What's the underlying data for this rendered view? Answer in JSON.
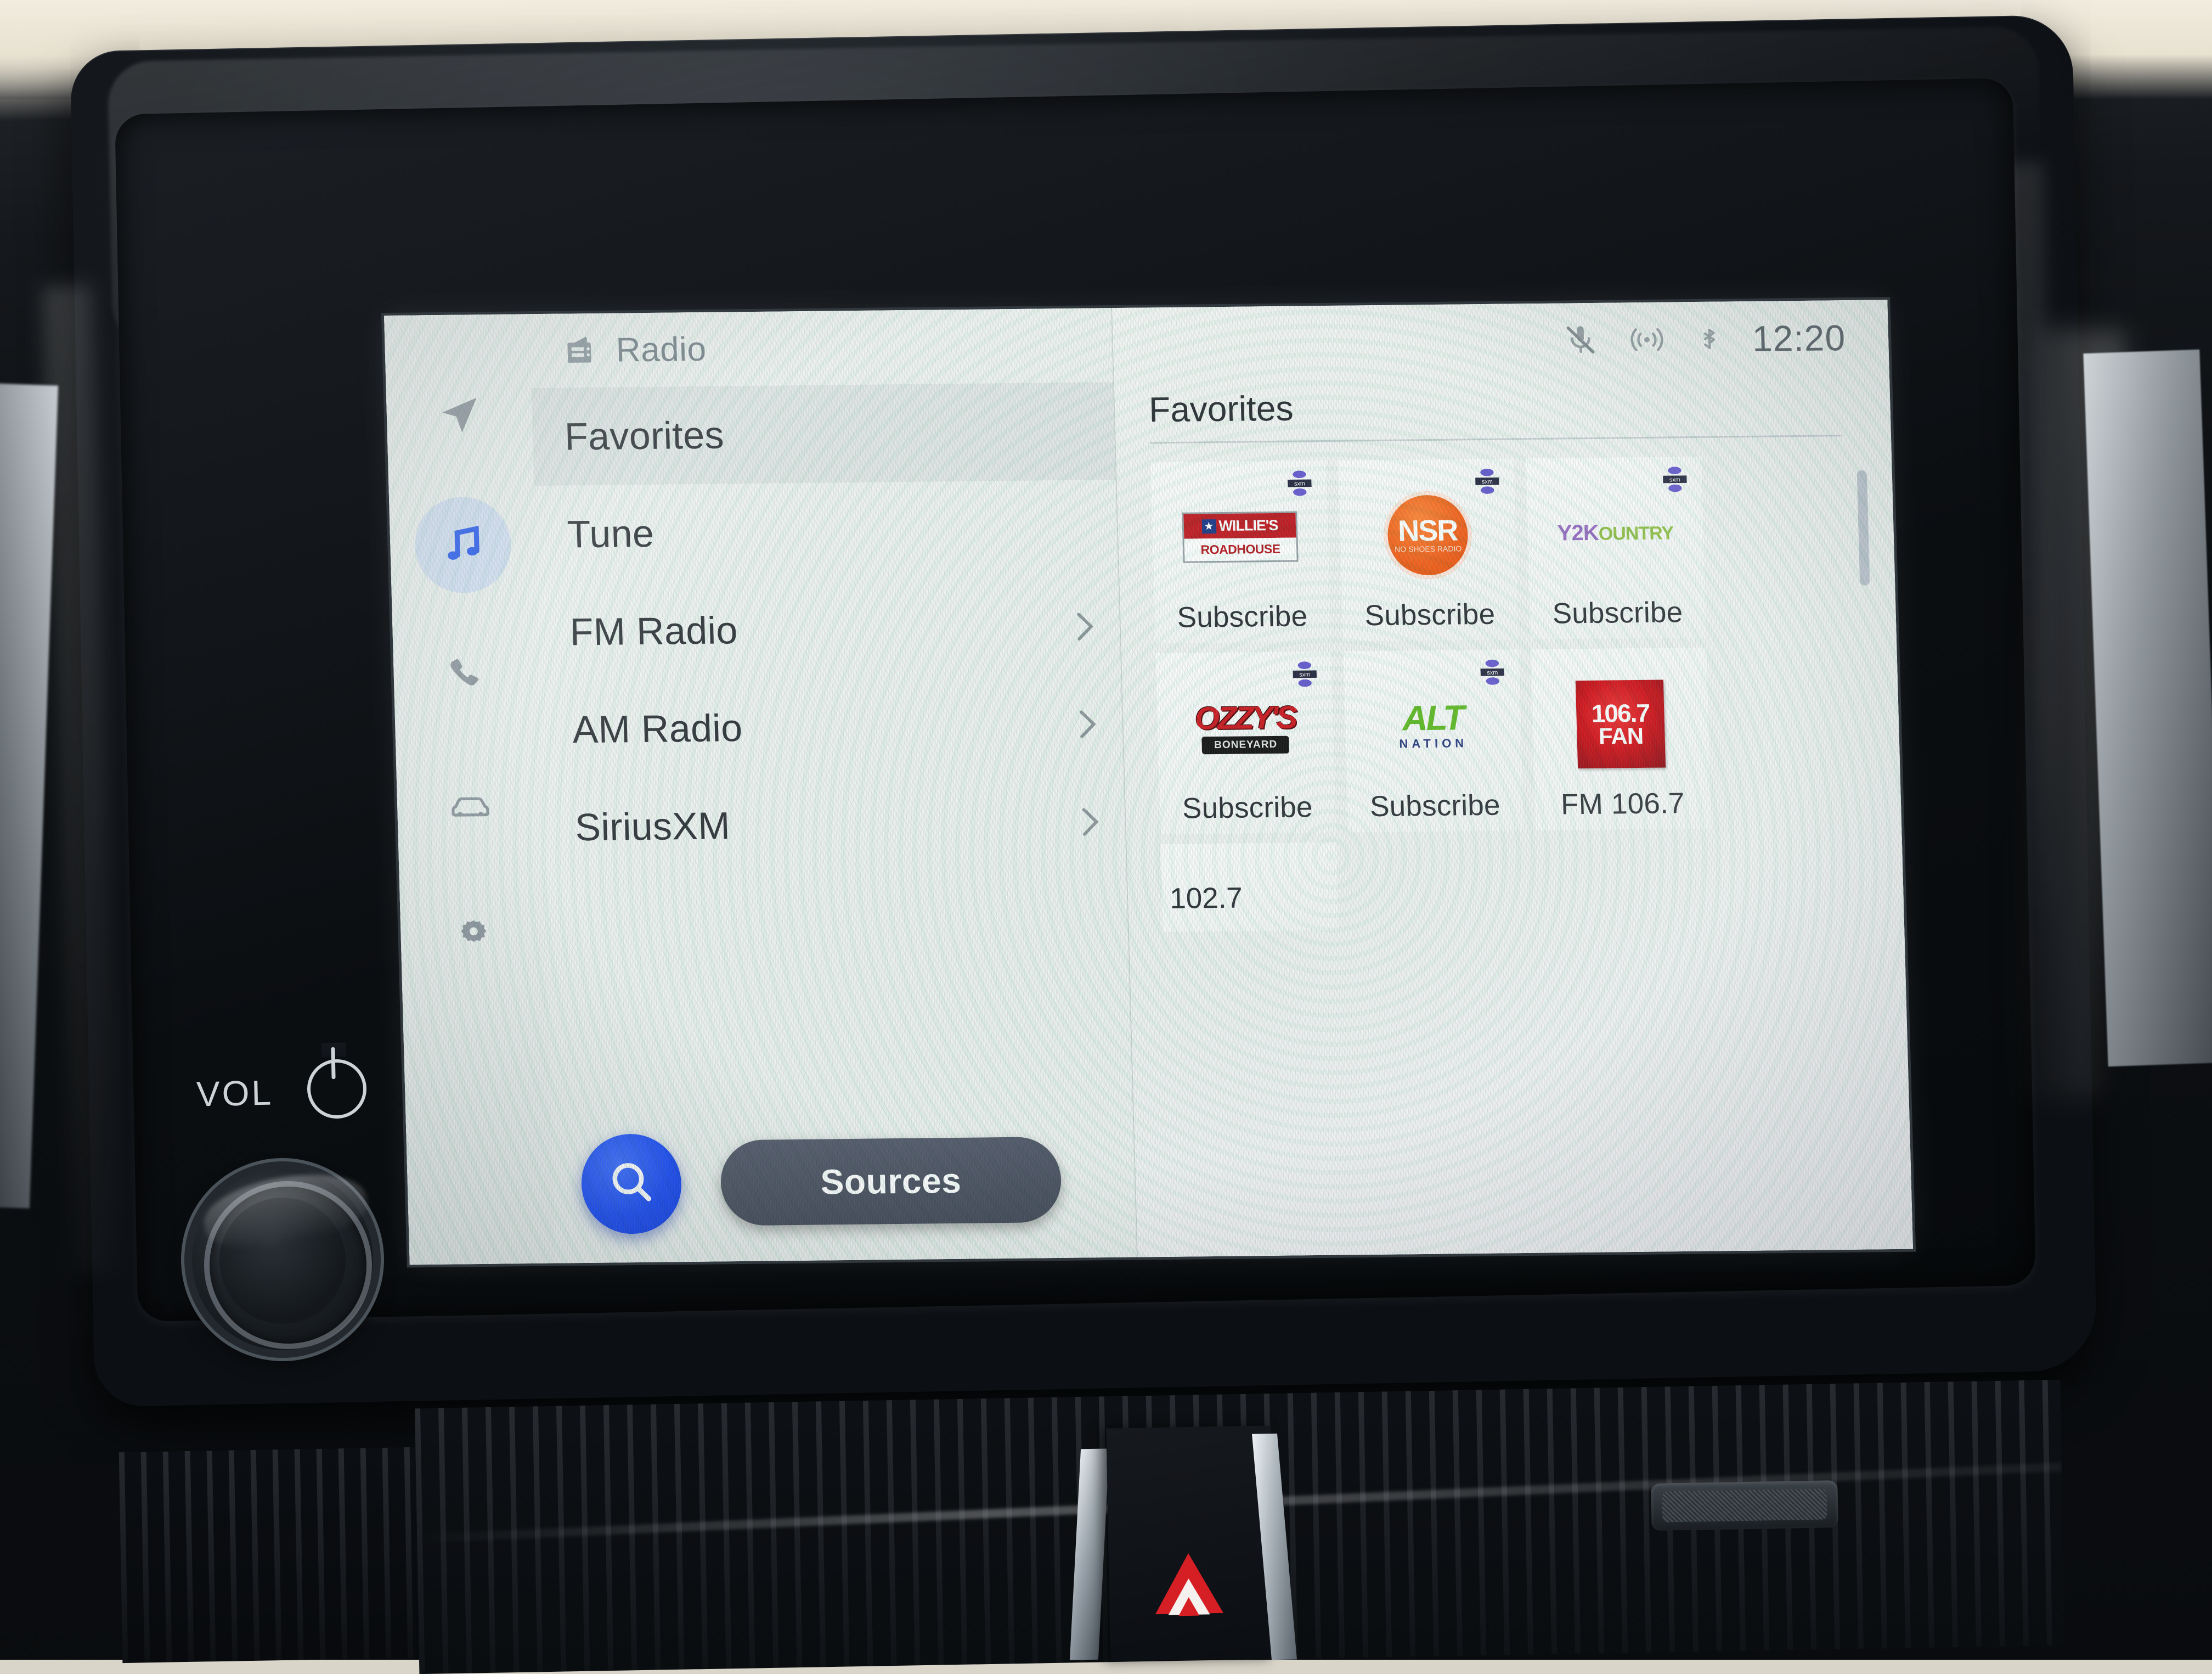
{
  "device": {
    "type": "car-infotainment-touchscreen",
    "hardware": {
      "vol_label": "VOL",
      "power_icon": "power-icon",
      "volume_knob": "volume-knob",
      "hazard_button": "hazard-triangle-icon"
    }
  },
  "screen": {
    "rail": {
      "items": [
        {
          "id": "navigation",
          "icon": "navigation-arrow-icon",
          "active": false
        },
        {
          "id": "media",
          "icon": "music-note-icon",
          "active": true
        },
        {
          "id": "phone",
          "icon": "phone-icon",
          "active": false
        },
        {
          "id": "vehicle",
          "icon": "car-icon",
          "active": false
        },
        {
          "id": "settings",
          "icon": "gear-icon",
          "active": false
        }
      ]
    },
    "source_header": {
      "icon": "radio-icon",
      "title": "Radio"
    },
    "menu": {
      "items": [
        {
          "label": "Favorites",
          "selected": true,
          "chevron": false
        },
        {
          "label": "Tune",
          "selected": false,
          "chevron": false
        },
        {
          "label": "FM Radio",
          "selected": false,
          "chevron": true
        },
        {
          "label": "AM Radio",
          "selected": false,
          "chevron": true
        },
        {
          "label": "SiriusXM",
          "selected": false,
          "chevron": true
        }
      ]
    },
    "actions": {
      "search_icon": "search-icon",
      "sources_label": "Sources"
    },
    "statusbar": {
      "icons": [
        "microphone-muted-icon",
        "signal-waves-icon",
        "bluetooth-icon"
      ],
      "clock": "12:20"
    },
    "favorites": {
      "title": "Favorites",
      "tiles": [
        {
          "logo": "willies-roadhouse",
          "caption": "Subscribe",
          "badge": "sxm",
          "logo_text": {
            "line1": "WILLIE'S",
            "line2": "ROADHOUSE"
          }
        },
        {
          "logo": "nsr",
          "caption": "Subscribe",
          "badge": "sxm",
          "logo_text": {
            "line1": "NSR",
            "line2": "NO SHOES RADIO"
          }
        },
        {
          "logo": "y2kountry",
          "caption": "Subscribe",
          "badge": "sxm",
          "logo_text": {
            "line1": "Y2K",
            "line2": "OUNTRY"
          }
        },
        {
          "logo": "ozzys-boneyard",
          "caption": "Subscribe",
          "badge": "sxm",
          "logo_text": {
            "line1": "OZZY'S",
            "line2": "BONEYARD"
          }
        },
        {
          "logo": "alt-nation",
          "caption": "Subscribe",
          "badge": "sxm",
          "logo_text": {
            "line1": "ALT",
            "line2": "NATION"
          }
        },
        {
          "logo": "fan-1067",
          "caption": "FM 106.7",
          "badge": null,
          "logo_text": {
            "line1": "106.7",
            "line2": "FAN"
          }
        }
      ],
      "partial_tile": {
        "caption": "102.7"
      },
      "scrollbar": true
    }
  },
  "colors": {
    "accent_blue": "#1c4ef5",
    "sources_button": "#4a5160",
    "text_primary": "#2d3338",
    "text_muted": "#77838b",
    "screen_bg": "#eef2f0",
    "willies_red": "#c22026",
    "nsr_orange": "#f4641f",
    "y2k_purple": "#9a6fc4",
    "y2k_green": "#93c24a",
    "ozzy_red": "#cf2026",
    "alt_green": "#62bb29",
    "alt_navy": "#2b3d82",
    "fan_red": "#d21118"
  }
}
